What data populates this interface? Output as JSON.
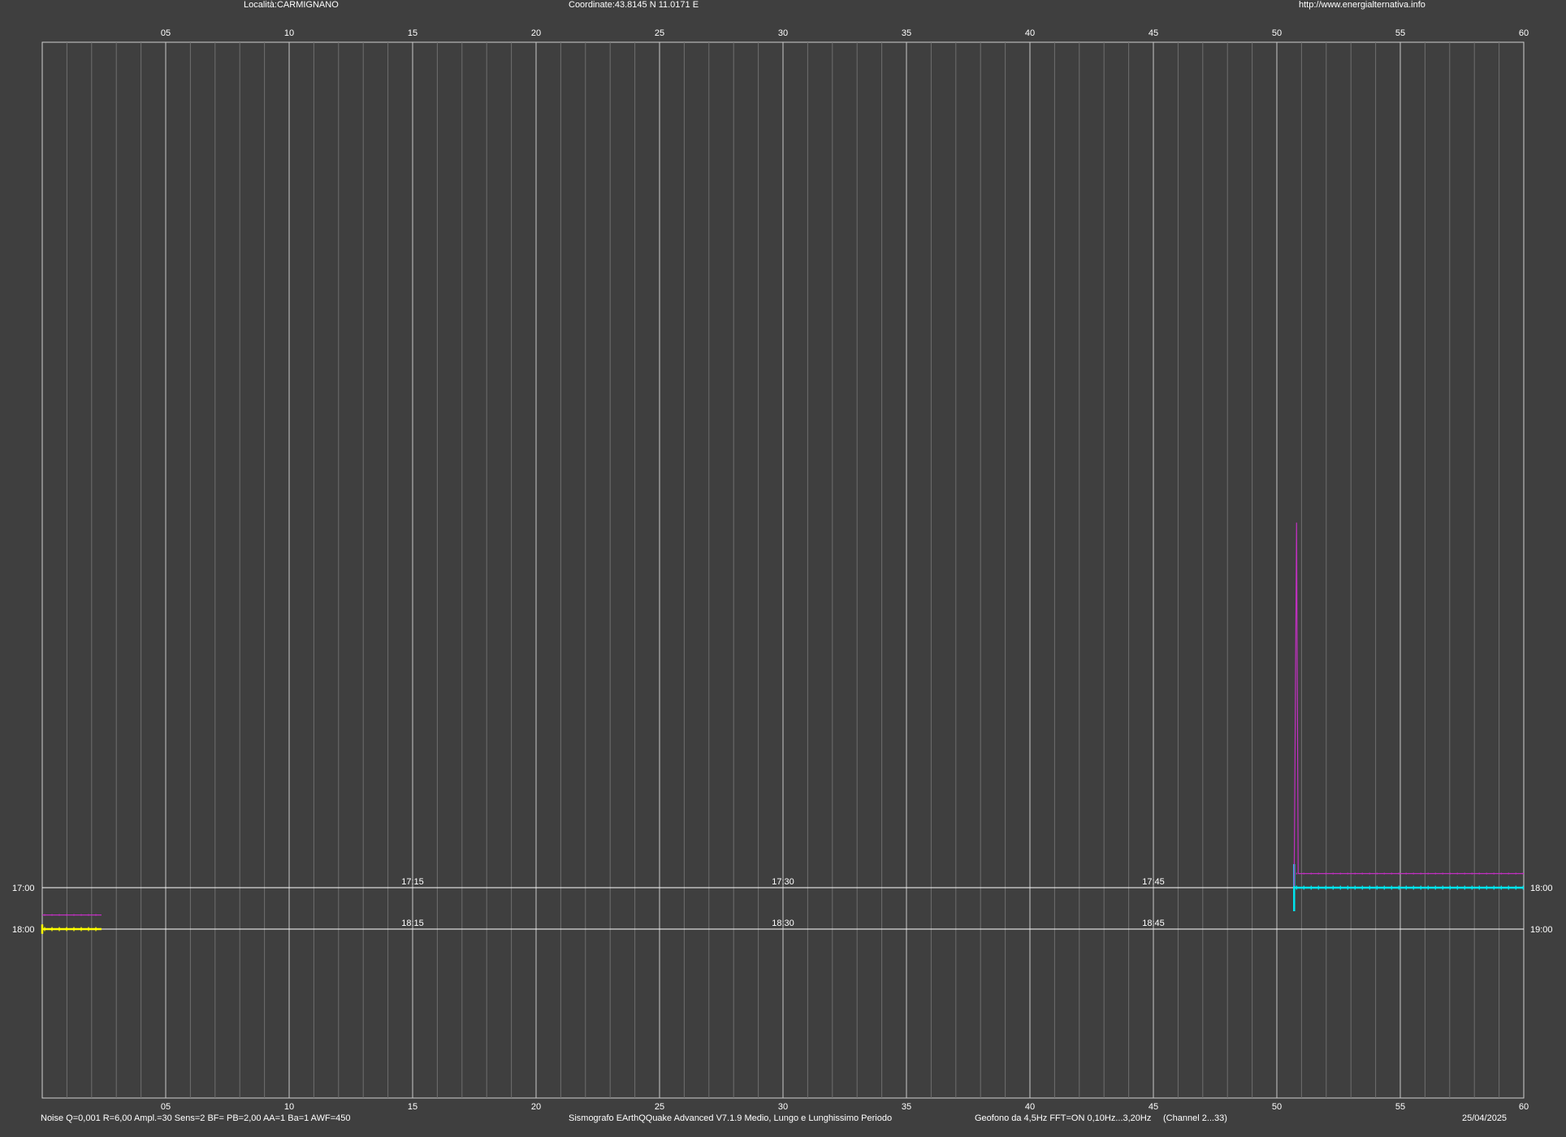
{
  "header": {
    "location": "Località:CARMIGNANO",
    "coordinates": "Coordinate:43.8145 N 11.0171 E",
    "url": "http://www.energialternativa.info"
  },
  "footer": {
    "params": "Noise Q=0,001 R=6,00 Ampl.=30 Sens=2 BF= PB=2,00 AA=1 Ba=1 AWF=450",
    "software": "Sismografo  EArthQQuake Advanced V7.1.9  Medio, Lungo e Lunghissimo Periodo",
    "sensor": "Geofono da 4,5Hz FFT=ON 0,10Hz...3,20Hz",
    "channel": "(Channel 2...33)",
    "date": "25/04/2025"
  },
  "chart_data": {
    "type": "line",
    "title": "",
    "xlabel": "",
    "ylabel": "",
    "x_unit": "minutes",
    "xlim": [
      0,
      60
    ],
    "x_tick_labels": [
      "05",
      "10",
      "15",
      "20",
      "25",
      "30",
      "35",
      "40",
      "45",
      "50",
      "55",
      "60"
    ],
    "grid": true,
    "legend": "none",
    "rows": [
      {
        "left_label": "17:00",
        "right_label": "18:00",
        "mid_labels": [
          "17:15",
          "17:30",
          "17:45"
        ],
        "line_color": "#ffffff",
        "series": [
          {
            "color": "#00e5ee",
            "x_start": 50.7,
            "x_end": 60,
            "baseline": 0,
            "spike_up": 1.0,
            "spike_down": -1.0
          },
          {
            "color": "#c030c0",
            "x_start": 50.7,
            "x_end": 60,
            "baseline": 0.6,
            "spike_up": 15.5
          }
        ]
      },
      {
        "left_label": "18:00",
        "right_label": "19:00",
        "mid_labels": [
          "18:15",
          "18:30",
          "18:45"
        ],
        "line_color": "#ffffff",
        "series": [
          {
            "color": "#ffff00",
            "x_start": 0,
            "x_end": 2.4,
            "baseline": 0,
            "spike_up": 0.2,
            "spike_down": -0.2
          },
          {
            "color": "#c030c0",
            "x_start": 0,
            "x_end": 2.4,
            "baseline": 0.6
          }
        ]
      }
    ],
    "colors": {
      "background": "#3f3f3f",
      "grid_major": "#c8c8c8",
      "grid_minor": "#6e6e6e",
      "frame": "#d0d0d0"
    }
  }
}
